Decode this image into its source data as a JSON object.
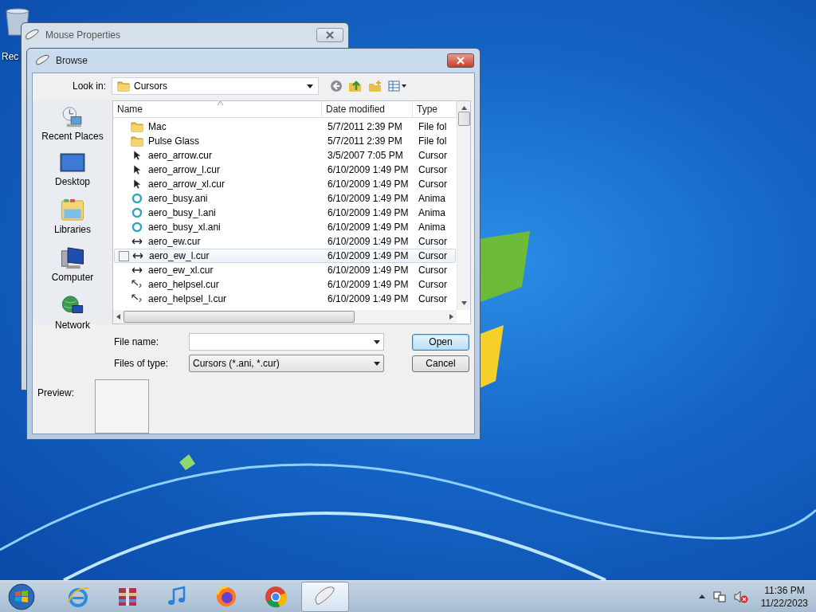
{
  "desktop": {
    "icons": [
      {
        "label": "Rec"
      }
    ]
  },
  "background_window": {
    "title": "Mouse Properties",
    "active": false
  },
  "dialog": {
    "title": "Browse",
    "active": true,
    "look_in": {
      "label": "Look in:",
      "value": "Cursors"
    },
    "places": [
      {
        "label": "Recent Places",
        "kind": "recent"
      },
      {
        "label": "Desktop",
        "kind": "desktop"
      },
      {
        "label": "Libraries",
        "kind": "libraries"
      },
      {
        "label": "Computer",
        "kind": "computer"
      },
      {
        "label": "Network",
        "kind": "network"
      }
    ],
    "file_list": {
      "columns": [
        "Name",
        "Date modified",
        "Type"
      ],
      "rows": [
        {
          "name": "Mac",
          "date": "5/7/2011 2:39 PM",
          "type": "File fol",
          "kind": "folder",
          "highlighted": false
        },
        {
          "name": "Pulse Glass",
          "date": "5/7/2011 2:39 PM",
          "type": "File fol",
          "kind": "folder",
          "highlighted": false
        },
        {
          "name": "aero_arrow.cur",
          "date": "3/5/2007 7:05 PM",
          "type": "Cursor",
          "kind": "arrow",
          "highlighted": false
        },
        {
          "name": "aero_arrow_l.cur",
          "date": "6/10/2009 1:49 PM",
          "type": "Cursor",
          "kind": "arrow",
          "highlighted": false
        },
        {
          "name": "aero_arrow_xl.cur",
          "date": "6/10/2009 1:49 PM",
          "type": "Cursor",
          "kind": "arrow",
          "highlighted": false
        },
        {
          "name": "aero_busy.ani",
          "date": "6/10/2009 1:49 PM",
          "type": "Anima",
          "kind": "busy",
          "highlighted": false
        },
        {
          "name": "aero_busy_l.ani",
          "date": "6/10/2009 1:49 PM",
          "type": "Anima",
          "kind": "busy",
          "highlighted": false
        },
        {
          "name": "aero_busy_xl.ani",
          "date": "6/10/2009 1:49 PM",
          "type": "Anima",
          "kind": "busy",
          "highlighted": false
        },
        {
          "name": "aero_ew.cur",
          "date": "6/10/2009 1:49 PM",
          "type": "Cursor",
          "kind": "resize",
          "highlighted": false
        },
        {
          "name": "aero_ew_l.cur",
          "date": "6/10/2009 1:49 PM",
          "type": "Cursor",
          "kind": "resize",
          "highlighted": true
        },
        {
          "name": "aero_ew_xl.cur",
          "date": "6/10/2009 1:49 PM",
          "type": "Cursor",
          "kind": "resize",
          "highlighted": false
        },
        {
          "name": "aero_helpsel.cur",
          "date": "6/10/2009 1:49 PM",
          "type": "Cursor",
          "kind": "help",
          "highlighted": false
        },
        {
          "name": "aero_helpsel_l.cur",
          "date": "6/10/2009 1:49 PM",
          "type": "Cursor",
          "kind": "help",
          "highlighted": false
        }
      ]
    },
    "file_name": {
      "label": "File name:"
    },
    "file_type": {
      "label": "Files of type:",
      "value": "Cursors (*.ani, *.cur)"
    },
    "buttons": [
      {
        "label": "Open",
        "default": true
      },
      {
        "label": "Cancel",
        "default": false
      }
    ],
    "preview": {
      "label": "Preview:"
    }
  },
  "taskbar": {
    "items": [
      {
        "kind": "ie",
        "active": false
      },
      {
        "kind": "archive",
        "active": false
      },
      {
        "kind": "music",
        "active": false
      },
      {
        "kind": "firefox",
        "active": false
      },
      {
        "kind": "chrome",
        "active": false
      },
      {
        "kind": "mouse",
        "active": true
      }
    ],
    "clock": {
      "time": "11:36 PM",
      "date": "11/22/2023"
    }
  }
}
